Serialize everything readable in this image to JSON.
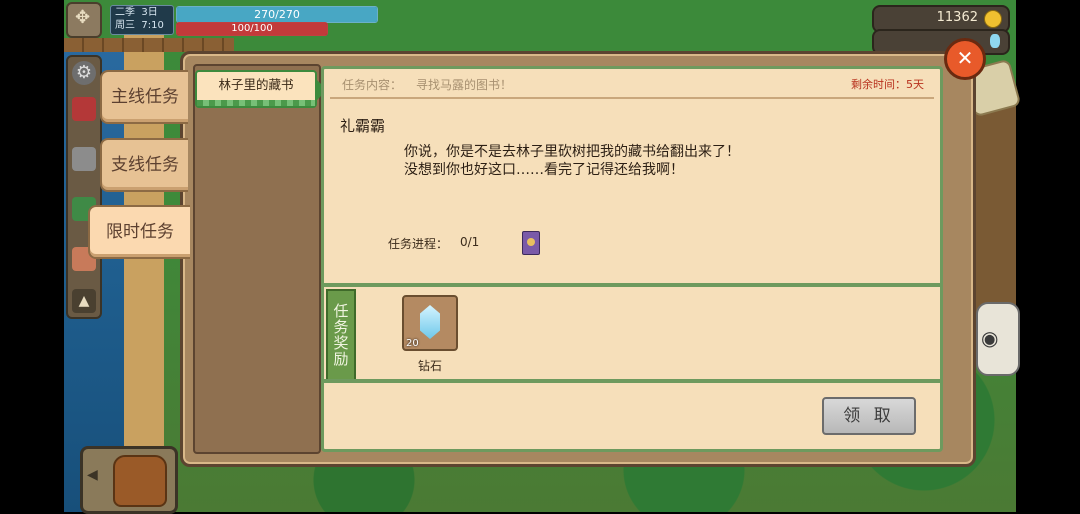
{
  "hud": {
    "date_line1": "二季  3日",
    "date_line2": "周三  7:10",
    "hp_text": "270/270",
    "hp_fraction": 1.0,
    "mp_text": "100/100",
    "mp_fraction": 1.0,
    "gold": "11362"
  },
  "side_tabs": {
    "main": "主线任务",
    "side": "支线任务",
    "limited": "限时任务"
  },
  "quest_list": [
    {
      "title": "林子里的藏书",
      "selected": true
    }
  ],
  "detail": {
    "content_label": "任务内容：",
    "content_text": "寻找马露的图书！",
    "time_label": "剩余时间：",
    "time_value": "5天",
    "npc_name": "礼霸霸",
    "dialogue_line1": "你说，你是不是去林子里砍树把我的藏书给翻出来了！",
    "dialogue_line2": "没想到你也好这口……看完了记得还给我啊！",
    "progress_label": "任务进程：",
    "progress_value": "0/1"
  },
  "reward": {
    "label": "任务奖励",
    "item_name": "钻石",
    "quantity": "20"
  },
  "buttons": {
    "claim": "领 取",
    "close": "✕"
  },
  "icons": [
    "gear-icon",
    "character-icon",
    "cart-icon",
    "map-icon",
    "box-icon",
    "up-arrow-icon",
    "book-icon",
    "diamond-icon",
    "gold-coin-icon",
    "gem-icon",
    "bag-icon",
    "close-icon"
  ]
}
